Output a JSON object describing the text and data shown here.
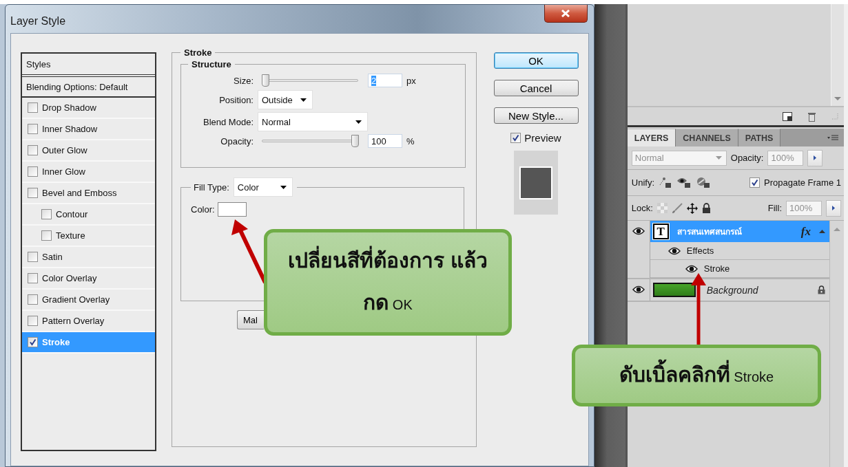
{
  "dialog": {
    "title": "Layer Style",
    "styles_list": {
      "header": "Styles",
      "blending_options": "Blending Options: Default",
      "items": [
        {
          "label": "Drop Shadow",
          "checked": false,
          "selected": false
        },
        {
          "label": "Inner Shadow",
          "checked": false,
          "selected": false
        },
        {
          "label": "Outer Glow",
          "checked": false,
          "selected": false
        },
        {
          "label": "Inner Glow",
          "checked": false,
          "selected": false
        },
        {
          "label": "Bevel and Emboss",
          "checked": false,
          "selected": false,
          "children": [
            {
              "label": "Contour",
              "checked": false,
              "selected": false
            },
            {
              "label": "Texture",
              "checked": false,
              "selected": false
            }
          ]
        },
        {
          "label": "Satin",
          "checked": false,
          "selected": false
        },
        {
          "label": "Color Overlay",
          "checked": false,
          "selected": false
        },
        {
          "label": "Gradient Overlay",
          "checked": false,
          "selected": false
        },
        {
          "label": "Pattern Overlay",
          "checked": false,
          "selected": false
        },
        {
          "label": "Stroke",
          "checked": true,
          "selected": true
        }
      ]
    },
    "stroke": {
      "title": "Stroke",
      "structure": {
        "title": "Structure",
        "size": {
          "label": "Size:",
          "level": 0,
          "value": "2",
          "value_selected": true,
          "unit": "px"
        },
        "position": {
          "label": "Position:",
          "value": "Outside"
        },
        "blend_mode": {
          "label": "Blend Mode:",
          "value": "Normal"
        },
        "opacity": {
          "label": "Opacity:",
          "level": 1,
          "value": "100",
          "unit": "%"
        }
      },
      "fill_type": {
        "label": "Fill Type:",
        "value": "Color"
      },
      "color": {
        "label": "Color:"
      },
      "default_button": "Mal"
    },
    "buttons": [
      {
        "label": "OK",
        "default": true
      },
      {
        "label": "Cancel",
        "default": false
      },
      {
        "label": "New Style...",
        "default": false
      }
    ],
    "preview": {
      "label": "Preview",
      "checked": true
    }
  },
  "layers_panel": {
    "tabs": [
      {
        "label": "LAYERS",
        "selected": true
      },
      {
        "label": "CHANNELS",
        "selected": false
      },
      {
        "label": "PATHS",
        "selected": false
      }
    ],
    "blend_mode": {
      "value": "Normal",
      "disabled": true
    },
    "opacity": {
      "label": "Opacity:",
      "value": "100%",
      "disabled": true
    },
    "unify": {
      "label": "Unify:"
    },
    "propagate": {
      "label": "Propagate Frame 1",
      "checked": true
    },
    "lock": {
      "label": "Lock:"
    },
    "fill": {
      "label": "Fill:",
      "value": "100%",
      "disabled": true
    },
    "layers": [
      {
        "kind": "text",
        "thumbnail": "T",
        "name": "สารสนเทศสนกรณ์",
        "badge": "fx",
        "selected": true,
        "visible": true,
        "children": [
          {
            "kind": "effects",
            "name": "Effects",
            "visible": true,
            "children": [
              {
                "kind": "effect",
                "name": "Stroke",
                "visible": true
              }
            ]
          }
        ]
      },
      {
        "kind": "image",
        "name": "Background",
        "selected": false,
        "visible": true,
        "locked": true
      }
    ]
  },
  "callouts": [
    {
      "text": "**เปลี่ยนสีที่ต้องการ แล้ว**\n**กด** OK"
    },
    {
      "text": "**ดับเบิ้ลคลิกที่** Stroke"
    }
  ]
}
